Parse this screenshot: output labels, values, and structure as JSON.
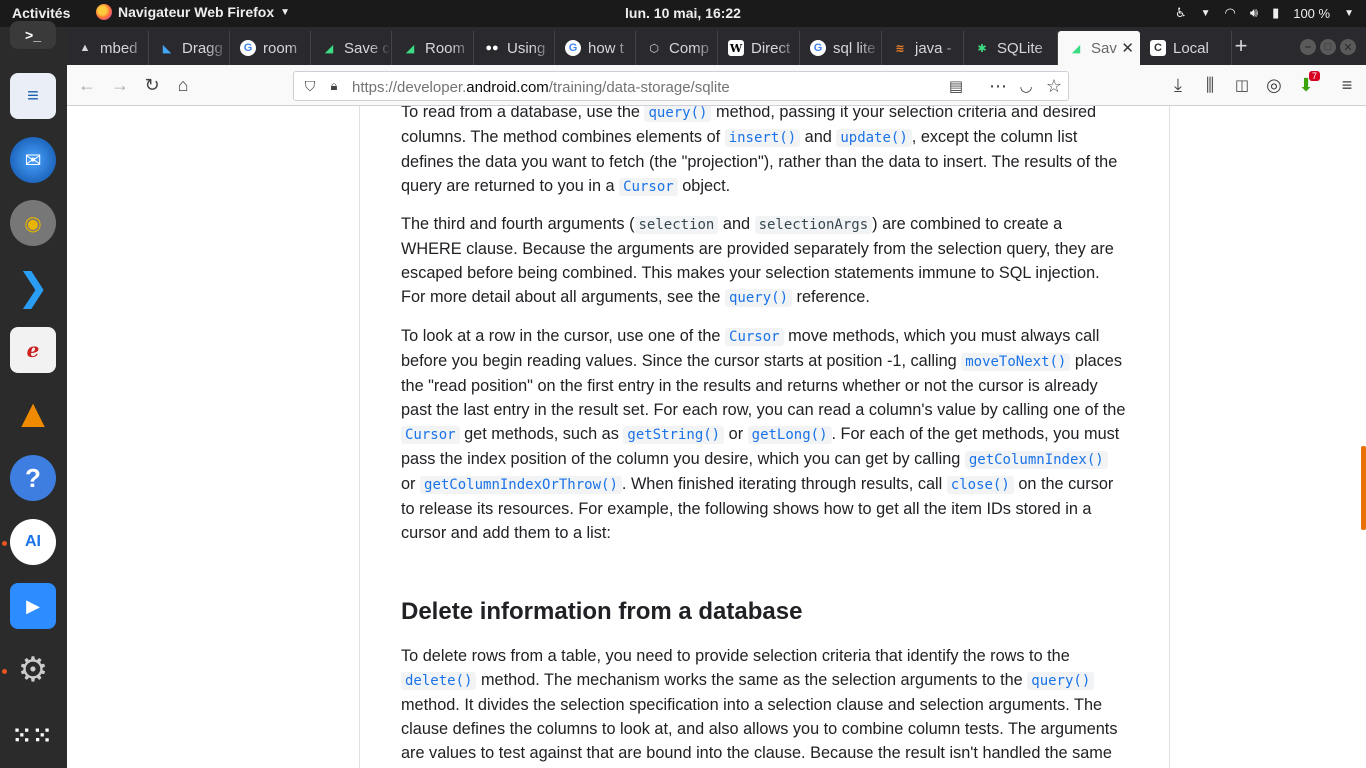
{
  "topbar": {
    "activities": "Activités",
    "app_menu": "Navigateur Web Firefox",
    "clock": "lun. 10 mai, 16:22",
    "battery": "100 %"
  },
  "tabs": [
    {
      "label": "mbed",
      "favicon": "triangle-warning-icon",
      "fav_color": "#d7d7db"
    },
    {
      "label": "Dragg",
      "favicon": "flutter-icon",
      "fav_color": "#42a5f5"
    },
    {
      "label": "room",
      "favicon": "google-icon",
      "fav_color": "#4285f4"
    },
    {
      "label": "Save c",
      "favicon": "android-icon",
      "fav_color": "#3ddc84"
    },
    {
      "label": "Room",
      "favicon": "android-icon",
      "fav_color": "#3ddc84"
    },
    {
      "label": "Using",
      "favicon": "medium-icon",
      "fav_color": "#ffffff"
    },
    {
      "label": "how t",
      "favicon": "google-icon",
      "fav_color": "#4285f4"
    },
    {
      "label": "Comp",
      "favicon": "compose-icon",
      "fav_color": "#d7d7db"
    },
    {
      "label": "Direct",
      "favicon": "wikipedia-icon",
      "fav_color": "#ffffff"
    },
    {
      "label": "sql lite",
      "favicon": "google-icon",
      "fav_color": "#4285f4"
    },
    {
      "label": "java -",
      "favicon": "stackoverflow-icon",
      "fav_color": "#f48024"
    },
    {
      "label": "SQLite",
      "favicon": "android-dev-icon",
      "fav_color": "#3ddc84"
    },
    {
      "label": "Sav",
      "favicon": "android-icon",
      "fav_color": "#3ddc84",
      "active": true
    },
    {
      "label": "Local",
      "favicon": "c-icon",
      "fav_color": "#ffffff"
    }
  ],
  "navbar": {
    "url_prefix": "https://developer.",
    "url_domain": "android.com",
    "url_path": "/training/data-storage/sqlite",
    "download_badge": "7"
  },
  "content": {
    "p1": [
      {
        "t": "To read from a database, use the "
      },
      {
        "c": "query()"
      },
      {
        "t": " method, passing it your selection criteria and desired columns. The method combines elements of "
      },
      {
        "c": "insert()"
      },
      {
        "t": " and "
      },
      {
        "c": "update()"
      },
      {
        "t": ", except the column list defines the data you want to fetch (the \"projection\"), rather than the data to insert. The results of the query are returned to you in a "
      },
      {
        "c": "Cursor"
      },
      {
        "t": " object."
      }
    ],
    "p2": [
      {
        "t": "The third and fourth arguments ("
      },
      {
        "c": "selection",
        "plain": true
      },
      {
        "t": " and "
      },
      {
        "c": "selectionArgs",
        "plain": true
      },
      {
        "t": ") are combined to create a WHERE clause. Because the arguments are provided separately from the selection query, they are escaped before being combined. This makes your selection statements immune to SQL injection. For more detail about all arguments, see the "
      },
      {
        "c": "query()"
      },
      {
        "t": " reference."
      }
    ],
    "p3": [
      {
        "t": "To look at a row in the cursor, use one of the "
      },
      {
        "c": "Cursor"
      },
      {
        "t": " move methods, which you must always call before you begin reading values. Since the cursor starts at position -1, calling "
      },
      {
        "c": "moveToNext()"
      },
      {
        "t": " places the \"read position\" on the first entry in the results and returns whether or not the cursor is already past the last entry in the result set. For each row, you can read a column's value by calling one of the "
      },
      {
        "c": "Cursor"
      },
      {
        "t": " get methods, such as "
      },
      {
        "c": "getString()"
      },
      {
        "t": " or "
      },
      {
        "c": "getLong()"
      },
      {
        "t": ". For each of the get methods, you must pass the index position of the column you desire, which you can get by calling "
      },
      {
        "c": "getColumnIndex()"
      },
      {
        "t": " or "
      },
      {
        "c": "getColumnIndexOrThrow()"
      },
      {
        "t": ". When finished iterating through results, call "
      },
      {
        "c": "close()"
      },
      {
        "t": " on the cursor to release its resources. For example, the following shows how to get all the item IDs stored in a cursor and add them to a list:"
      }
    ],
    "heading": "Delete information from a database",
    "p4": [
      {
        "t": "To delete rows from a table, you need to provide selection criteria that identify the rows to the "
      },
      {
        "c": "delete()"
      },
      {
        "t": " method. The mechanism works the same as the selection arguments to the "
      },
      {
        "c": "query()"
      },
      {
        "t": " method. It divides the selection specification into a selection clause and selection arguments. The clause defines the columns to look at, and also allows you to combine column tests. The arguments are values to test against that are bound into the clause. Because the result isn't handled the same as"
      }
    ]
  }
}
